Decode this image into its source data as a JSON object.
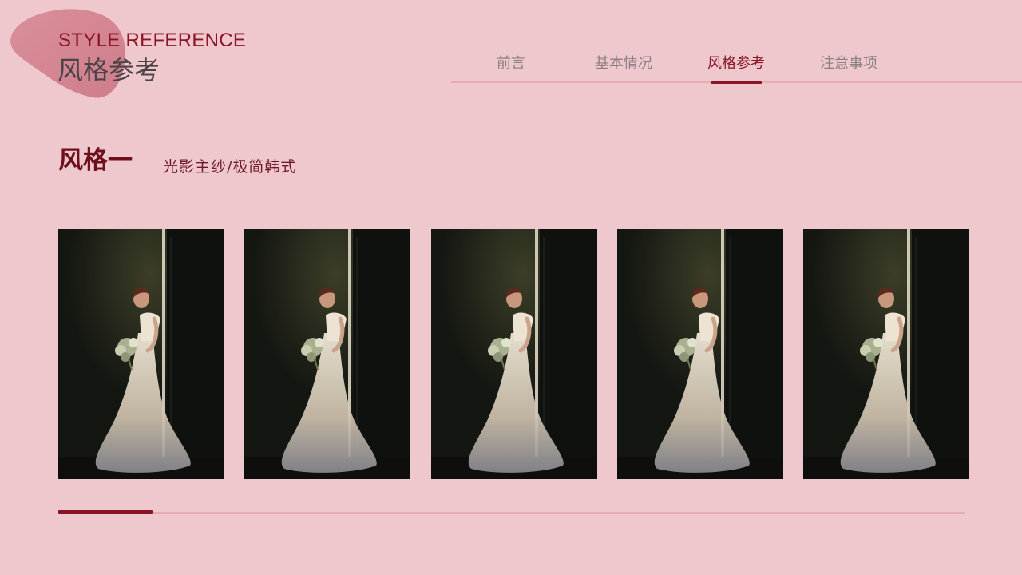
{
  "header": {
    "title_en": "STYLE REFERENCE",
    "title_cn": "风格参考"
  },
  "nav": {
    "items": [
      {
        "label": "前言",
        "active": false
      },
      {
        "label": "基本情况",
        "active": false
      },
      {
        "label": "风格参考",
        "active": true
      },
      {
        "label": "注意事项",
        "active": false
      }
    ]
  },
  "section": {
    "title": "风格一",
    "subtitle": "光影主纱/极简韩式"
  },
  "gallery": {
    "count": 5
  },
  "progress": {
    "fraction": 0.104
  },
  "colors": {
    "background": "#efc8ce",
    "accent": "#8c1525",
    "blob": "#d98b96",
    "muted_line": "#e8aab3"
  }
}
